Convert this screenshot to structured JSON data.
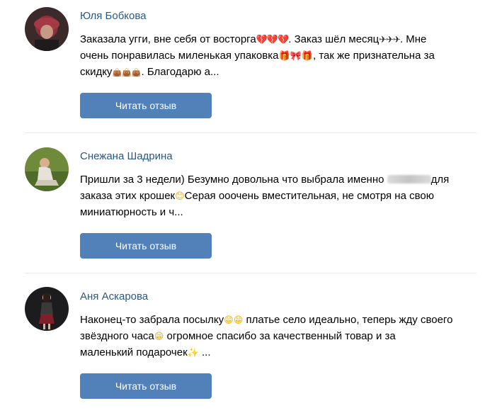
{
  "reviews": [
    {
      "name": "Юля Бобкова",
      "text_l1_a": "Заказала угги, вне себя от восторга",
      "text_l1_b": ". Заказ шёл месяц",
      "text_l1_c": ". Мне",
      "text_l2_a": "очень понравилась миленькая упаковка",
      "text_l2_b": ", так же признательна за",
      "text_l3_a": "скидку",
      "text_l3_b": ". Благодарю а...",
      "button_label": "Читать отзыв"
    },
    {
      "name": "Снежана Шадрина",
      "text_l1_a": "Пришли за 3 недели) Безумно довольна что выбрала именно",
      "text_l1_b": "для",
      "text_l2_a": "заказа этих крошек",
      "text_l2_b": "Серая ооочень вместительная, не смотря на свою",
      "text_l3_a": "миниатюрность и ч...",
      "button_label": "Читать отзыв"
    },
    {
      "name": "Аня Аскарова",
      "text_l1_a": "Наконец-то забрала посылку",
      "text_l1_b": " платье село идеально, теперь жду своего",
      "text_l2_a": "звёздного часа",
      "text_l2_b": " огромное спасибо за качественный товар и за",
      "text_l3_a": "маленький подарочек",
      "text_l3_b": " ...",
      "button_label": "Читать отзыв"
    }
  ],
  "emoji": {
    "hearts": "💔💔💔",
    "planes": "✈✈✈",
    "gift_set": "🎁🎀🎁",
    "bags": "👜👜👜",
    "smile": "😊",
    "grin_pair": "😁😁",
    "grin": "😁",
    "sparkles": "✨"
  },
  "colors": {
    "name_link": "#2a5885",
    "button_bg": "#5181b8",
    "button_text": "#ffffff",
    "divider": "#e7e8ec"
  }
}
